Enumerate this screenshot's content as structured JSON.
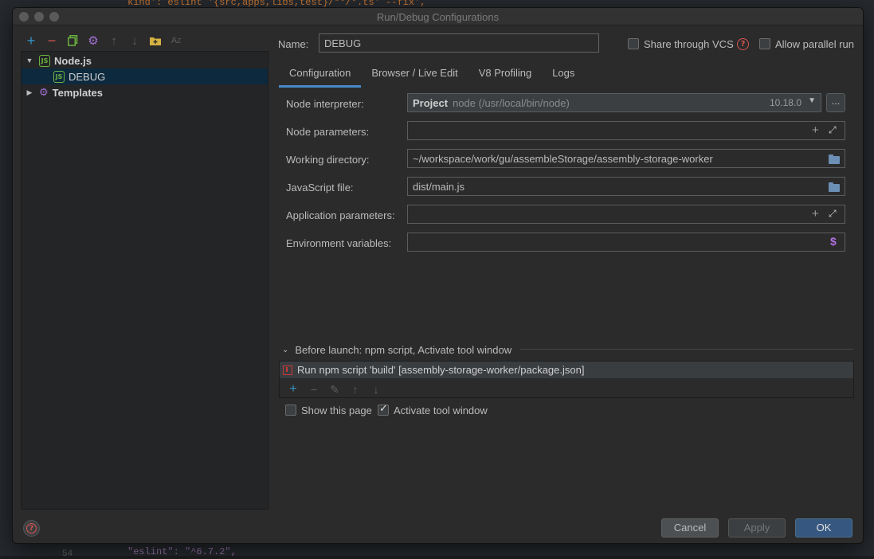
{
  "window": {
    "title": "Run/Debug Configurations"
  },
  "left_toolbar": {
    "icons": [
      "add-icon",
      "remove-icon",
      "copy-icon",
      "settings-icon",
      "move-up-icon",
      "move-down-icon",
      "new-folder-icon",
      "sort-icon"
    ]
  },
  "tree": {
    "nodejs_label": "Node.js",
    "debug_label": "DEBUG",
    "templates_label": "Templates",
    "node_icon_text": "JS"
  },
  "header": {
    "name_label": "Name:",
    "name_value": "DEBUG",
    "share_vcs_label": "Share through VCS",
    "share_vcs_checked": false,
    "allow_parallel_label": "Allow parallel run",
    "allow_parallel_checked": false
  },
  "tabs": [
    {
      "label": "Configuration",
      "active": true
    },
    {
      "label": "Browser / Live Edit",
      "active": false
    },
    {
      "label": "V8 Profiling",
      "active": false
    },
    {
      "label": "Logs",
      "active": false
    }
  ],
  "form": {
    "node_interpreter_label": "Node interpreter:",
    "interpreter_project": "Project",
    "interpreter_path": "node (/usr/local/bin/node)",
    "interpreter_version": "10.18.0",
    "browse_label": "...",
    "node_parameters_label": "Node parameters:",
    "node_parameters_value": "",
    "working_directory_label": "Working directory:",
    "working_directory_value": "~/workspace/work/gu/assembleStorage/assembly-storage-worker",
    "javascript_file_label": "JavaScript file:",
    "javascript_file_value": "dist/main.js",
    "application_parameters_label": "Application parameters:",
    "application_parameters_value": "",
    "environment_variables_label": "Environment variables:",
    "environment_variables_value": ""
  },
  "before_launch": {
    "header": "Before launch: npm script, Activate tool window",
    "task": "Run npm script 'build' [assembly-storage-worker/package.json]"
  },
  "options": {
    "show_this_page_label": "Show this page",
    "show_this_page_checked": false,
    "activate_tool_window_label": "Activate tool window",
    "activate_tool_window_checked": true
  },
  "buttons": {
    "cancel": "Cancel",
    "apply": "Apply",
    "ok": "OK"
  },
  "editor_background": {
    "line_top": "kind': eslint '{src,apps,libs,test}/**/*.ts' --fix',",
    "line_bottom": "\"eslint\": \"^6.7.2\",",
    "gutter_number": "54"
  },
  "colors": {
    "accent": "#4a88c7",
    "ok_button": "#365880",
    "selection": "#0d293e",
    "nodejs_green": "#6cb33f",
    "error_red": "#d9534f"
  }
}
